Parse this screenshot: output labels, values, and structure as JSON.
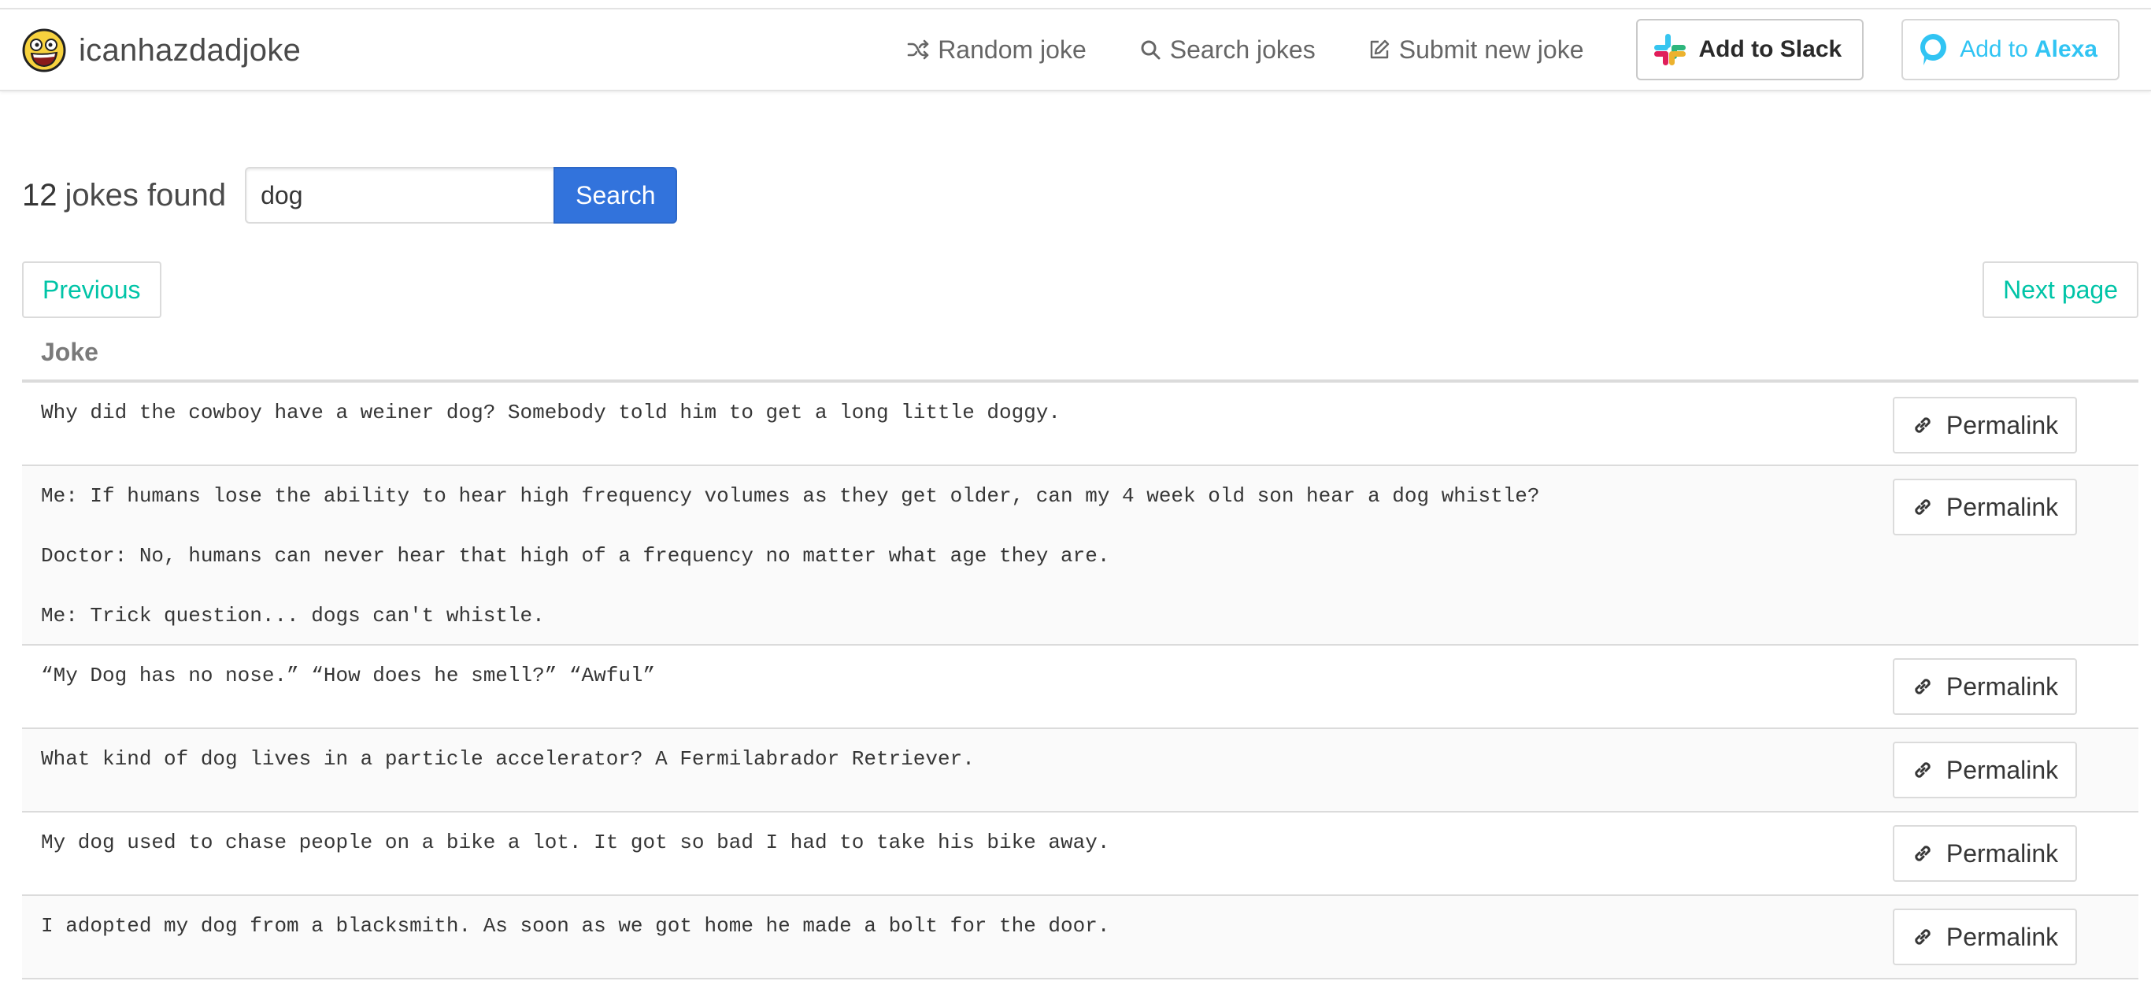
{
  "brand": {
    "name": "icanhazdadjoke"
  },
  "nav": {
    "random": "Random joke",
    "search": "Search jokes",
    "submit": "Submit new joke",
    "slack": "Add to Slack",
    "alexa_prefix": "Add to",
    "alexa_brand": "Alexa"
  },
  "search": {
    "count": "12",
    "count_suffix": "jokes found",
    "value": "dog",
    "button": "Search"
  },
  "pagination": {
    "previous": "Previous",
    "next": "Next page"
  },
  "table": {
    "header": "Joke",
    "permalink_label": "Permalink",
    "rows": [
      {
        "lines": [
          "Why did the cowboy have a weiner dog? Somebody told him to get a long little doggy."
        ]
      },
      {
        "lines": [
          "Me: If humans lose the ability to hear high frequency volumes as they get older, can my 4 week old son hear a dog whistle?",
          "Doctor: No, humans can never hear that high of a frequency no matter what age they are.",
          "Me: Trick question... dogs can't whistle."
        ]
      },
      {
        "lines": [
          "“My Dog has no nose.” “How does he smell?” “Awful”"
        ]
      },
      {
        "lines": [
          "What kind of dog lives in a particle accelerator? A Fermilabrador Retriever."
        ]
      },
      {
        "lines": [
          "My dog used to chase people on a bike a lot. It got so bad I had to take his bike away."
        ]
      },
      {
        "lines": [
          "I adopted my dog from a blacksmith. As soon as we got home he made a bolt for the door."
        ]
      }
    ]
  },
  "colors": {
    "primary": "#3273dc",
    "link": "#00c4a7",
    "alexa": "#31c4f3"
  }
}
